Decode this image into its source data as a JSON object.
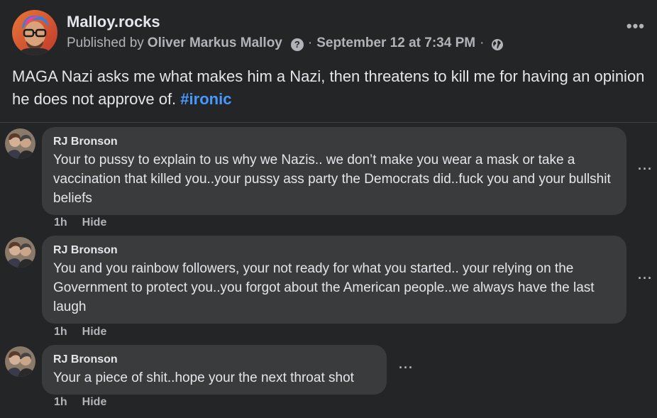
{
  "post": {
    "page_name": "Malloy.rocks",
    "published_by_label": "Published by",
    "author": "Oliver Markus Malloy",
    "separator": "·",
    "date": "September 12 at 7:34 PM",
    "text": "MAGA Nazi asks me what makes him a Nazi, then threatens to kill me for having an opinion he does not approve of.",
    "hashtag": "#ironic",
    "more_label": "•••",
    "help_icon_label": "?",
    "icons": {
      "avatar": "cartoon-avatar-icon",
      "help": "question-icon",
      "privacy": "globe-icon",
      "more": "more-icon"
    }
  },
  "comments": [
    {
      "author": "RJ Bronson",
      "text": "Your to pussy to explain to us why we Nazis.. we don’t make you wear a mask or take a vaccination that killed you..your pussy ass party the Democrats did..fuck you and your bullshit beliefs",
      "time": "1h",
      "hide_label": "Hide",
      "more_label": "···"
    },
    {
      "author": "RJ Bronson",
      "text": "You and you rainbow followers, your not ready for what you started.. your relying on the Government to protect you..you forgot about the American people..we always have the last laugh",
      "time": "1h",
      "hide_label": "Hide",
      "more_label": "···"
    },
    {
      "author": "RJ Bronson",
      "text": "Your a piece of shit..hope your the next throat shot",
      "time": "1h",
      "hide_label": "Hide",
      "more_label": "···"
    }
  ],
  "colors": {
    "background": "#242526",
    "bubble": "#3a3b3c",
    "text": "#e4e6eb",
    "secondary": "#b0b3b8",
    "link": "#4599ff"
  }
}
